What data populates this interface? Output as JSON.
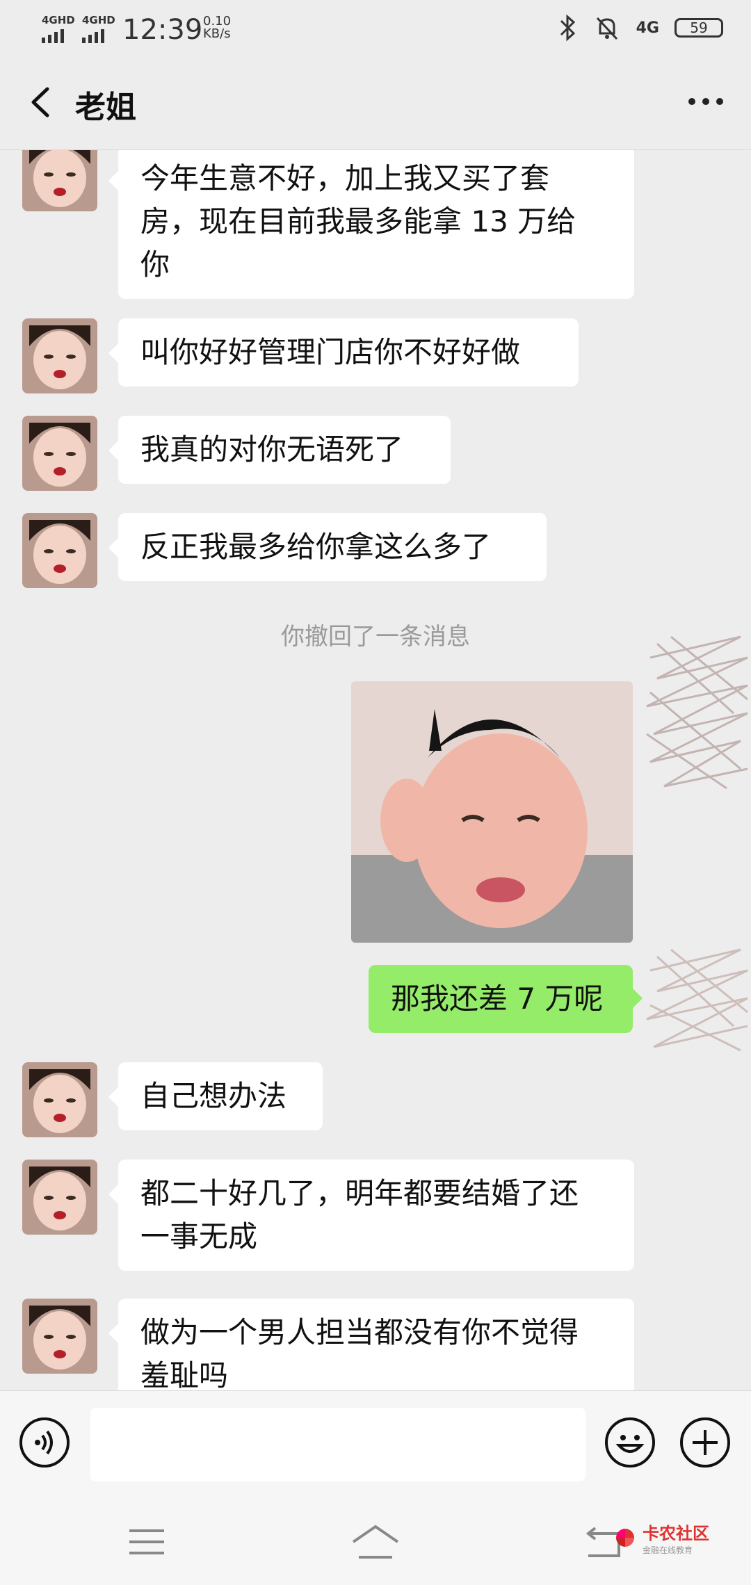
{
  "status_bar": {
    "signal1": "4GHD",
    "signal2": "4GHD",
    "time": "12:39",
    "net_speed_value": "0.10",
    "net_speed_unit": "KB/s",
    "network_right": "4G",
    "battery": "59"
  },
  "header": {
    "title": "老姐"
  },
  "messages": [
    {
      "text_lines": [
        "今年生意不好，加上我又买了套",
        "房，现在目前我最多能拿 13 万给",
        "你"
      ]
    },
    {
      "text": "叫你好好管理门店你不好好做"
    },
    {
      "text": "我真的对你无语死了"
    },
    {
      "text": "反正我最多给你拿这么多了"
    },
    {
      "recall_notice": "你撤回了一条消息"
    },
    {
      "self_text": "那我还差 7 万呢"
    },
    {
      "text": "自己想办法"
    },
    {
      "text_lines": [
        "都二十好几了，明年都要结婚了还",
        "一事无成"
      ]
    },
    {
      "text_lines": [
        "做为一个男人担当都没有你不觉得",
        "羞耻吗"
      ]
    }
  ],
  "watermark": {
    "title": "卡农社区",
    "subtitle": "金融在线教育"
  },
  "colors": {
    "background": "#ededed",
    "self_bubble": "#95ec69",
    "other_bubble": "#ffffff"
  }
}
